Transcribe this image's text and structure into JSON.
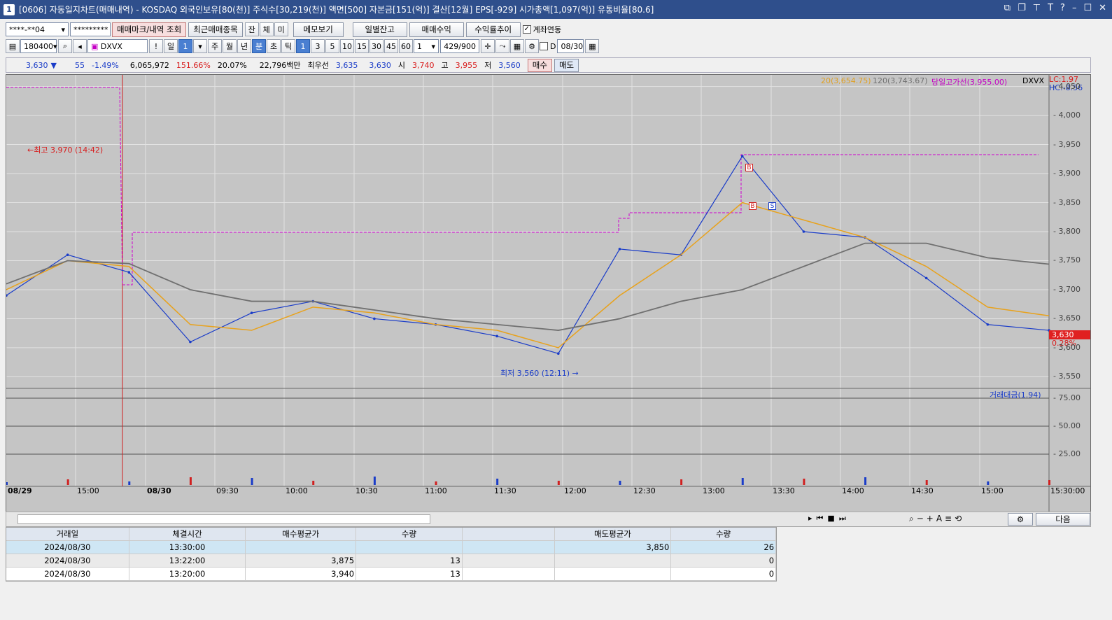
{
  "title": {
    "code": "[0606]",
    "text": "자동일지차트(매매내역) - KOSDAQ 외국인보유[80(천)] 주식수[30,219(천)] 액면[500] 자본금[151(억)] 결산[12월] EPS[-929] 시가총액[1,097(억)] 유통비율[80.6]"
  },
  "toolbar1": {
    "account": "****-**04",
    "password": "*********",
    "btn_trade_marks": "매매마크/내역 조회",
    "btn_recent": "최근매매종목",
    "t1": "잔",
    "t2": "체",
    "t3": "미",
    "btn_memo": "메모보기",
    "btn_daily_balance": "일별잔고",
    "btn_trade_profit": "매매수익",
    "btn_return_trend": "수익률추이",
    "chk_account_link": "계좌연동"
  },
  "toolbar2": {
    "code": "180400",
    "name": "DXVX",
    "p_day": "일",
    "p_num": "1",
    "p_week": "주",
    "p_month": "월",
    "p_year": "년",
    "p_min": "분",
    "p_sec": "초",
    "p_tick": "틱",
    "m1": "1",
    "m3": "3",
    "m5": "5",
    "m10": "10",
    "m15": "15",
    "m30": "30",
    "m45": "45",
    "m60": "60",
    "unit": "1",
    "count": "429/900",
    "d_label": "D",
    "date": "08/30"
  },
  "info": {
    "price": "3,630",
    "arrow": "▼",
    "change": "55",
    "pct": "-1.49%",
    "volume": "6,065,972",
    "vol_rate": "151.66%",
    "turnover": "20.07%",
    "amount": "22,796백만",
    "label_best": "최우선",
    "best_ask": "3,635",
    "best_bid": "3,630",
    "label_open": "시",
    "open": "3,740",
    "label_high": "고",
    "high": "3,955",
    "label_low": "저",
    "low": "3,560",
    "btn_buy": "매수",
    "btn_sell": "매도"
  },
  "chart": {
    "legend_ma20": "20(3,654.75)",
    "legend_ma120": "120(3,743.67)",
    "legend_high_line": "당일고가선(3,955.00)",
    "legend_name": "DXVX",
    "lc": "LC:1.97",
    "hc": "HC:-8.56",
    "high_label": "←최고 3,970 (14:42)",
    "low_label": "최저 3,560 (12:11) →",
    "cur_price": "3,630",
    "cur_pct": "0.28%",
    "vol_legend": "거래대금(1.94)",
    "mark_b1": "B",
    "mark_b2": "B",
    "mark_s": "S",
    "y_ticks": [
      "4,050",
      "4,000",
      "3,950",
      "3,900",
      "3,850",
      "3,800",
      "3,750",
      "3,700",
      "3,650",
      "3,600",
      "3,550"
    ],
    "vol_ticks": [
      "75.00",
      "50.00",
      "25.00"
    ],
    "x_ticks": [
      "08/29",
      "15:00",
      "08/30",
      "09:30",
      "10:00",
      "10:30",
      "11:00",
      "11:30",
      "12:00",
      "12:30",
      "13:00",
      "13:30",
      "14:00",
      "14:30",
      "15:00",
      "15:30:00"
    ]
  },
  "chart_data": {
    "type": "line",
    "title": "",
    "ylim": [
      3530,
      4070
    ],
    "x": [
      "08/29 14:40",
      "08/29 15:00",
      "08/30 09:00",
      "08/30 09:30",
      "08/30 10:00",
      "08/30 10:30",
      "08/30 11:00",
      "08/30 11:30",
      "08/30 12:00",
      "08/30 12:15",
      "08/30 12:30",
      "08/30 13:00",
      "08/30 13:15",
      "08/30 13:30",
      "08/30 14:00",
      "08/30 14:30",
      "08/30 15:00",
      "08/30 15:20"
    ],
    "series": [
      {
        "name": "DXVX",
        "values": [
          3690,
          3760,
          3730,
          3610,
          3660,
          3680,
          3650,
          3640,
          3620,
          3590,
          3770,
          3760,
          3930,
          3800,
          3790,
          3720,
          3640,
          3630
        ]
      },
      {
        "name": "20",
        "values": [
          3700,
          3750,
          3740,
          3640,
          3630,
          3670,
          3660,
          3640,
          3630,
          3600,
          3690,
          3760,
          3850,
          3820,
          3790,
          3740,
          3670,
          3655
        ]
      },
      {
        "name": "120",
        "values": [
          3710,
          3750,
          3745,
          3700,
          3680,
          3680,
          3665,
          3650,
          3640,
          3630,
          3650,
          3680,
          3700,
          3740,
          3780,
          3780,
          3755,
          3744
        ]
      }
    ]
  },
  "grid": {
    "headers": [
      "거래일",
      "체결시간",
      "매수평균가",
      "수량",
      "",
      "매도평균가",
      "수량"
    ],
    "rows": [
      [
        "2024/08/30",
        "13:30:00",
        "",
        "",
        "",
        "3,850",
        "26"
      ],
      [
        "2024/08/30",
        "13:22:00",
        "3,875",
        "13",
        "",
        "",
        "0"
      ],
      [
        "2024/08/30",
        "13:20:00",
        "3,940",
        "13",
        "",
        "",
        "0"
      ]
    ],
    "btn_next": "다음"
  }
}
